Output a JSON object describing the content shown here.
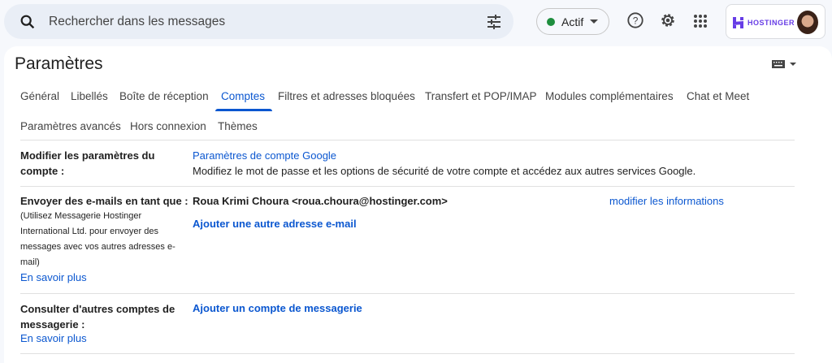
{
  "search": {
    "placeholder": "Rechercher dans les messages"
  },
  "status": {
    "label": "Actif",
    "color": "#1e8e3e"
  },
  "account": {
    "brand": "HOSTINGER"
  },
  "page": {
    "title": "Paramètres"
  },
  "tabs": [
    "Général",
    "Libellés",
    "Boîte de réception",
    "Comptes",
    "Filtres et adresses bloquées",
    "Transfert et POP/IMAP",
    "Modules complémentaires",
    "Chat et Meet",
    "Paramètres avancés",
    "Hors connexion",
    "Thèmes"
  ],
  "active_tab": "Comptes",
  "sections": {
    "change": {
      "label": "Modifier les paramètres du compte :",
      "link": "Paramètres de compte Google",
      "desc": "Modifiez le mot de passe et les options de sécurité de votre compte et accédez aux autres services Google."
    },
    "sendas": {
      "label": "Envoyer des e-mails en tant que :",
      "note": "(Utilisez Messagerie Hostinger International Ltd. pour envoyer des messages avec vos autres adresses e-mail)",
      "learn": "En savoir plus",
      "identity": "Roua Krimi Choura <roua.choura@hostinger.com>",
      "edit": "modifier les informations",
      "add": "Ajouter une autre adresse e-mail"
    },
    "check": {
      "label": "Consulter d'autres comptes de messagerie :",
      "learn": "En savoir plus",
      "add": "Ajouter un compte de messagerie"
    }
  }
}
